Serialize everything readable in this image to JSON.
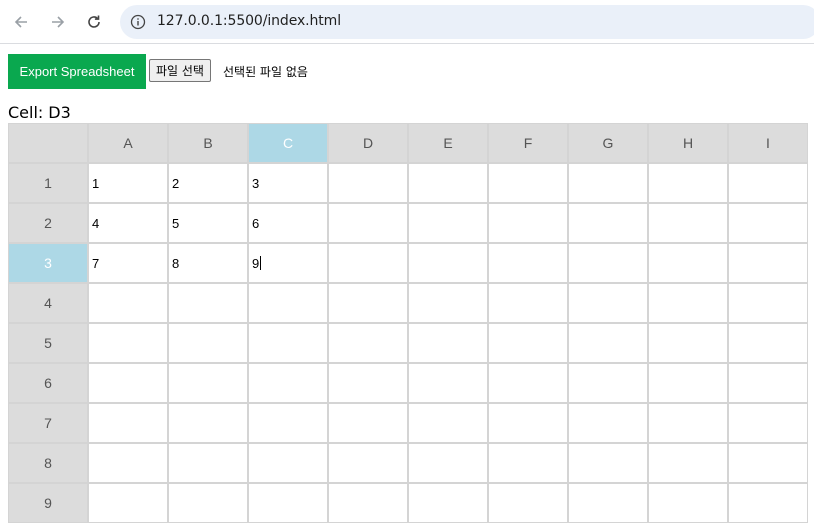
{
  "browser": {
    "url": "127.0.0.1:5500/index.html"
  },
  "toolbar": {
    "export_label": "Export Spreadsheet",
    "file_button_label": "파일 선택",
    "file_status": "선택된 파일 없음"
  },
  "cell_indicator": {
    "prefix": "Cell:",
    "value": "D3"
  },
  "sheet": {
    "columns": [
      "A",
      "B",
      "C",
      "D",
      "E",
      "F",
      "G",
      "H",
      "I"
    ],
    "rows": [
      "1",
      "2",
      "3",
      "4",
      "5",
      "6",
      "7",
      "8",
      "9"
    ],
    "active_column": "C",
    "active_row": "3",
    "cells": [
      [
        "1",
        "2",
        "3",
        "",
        "",
        "",
        "",
        "",
        ""
      ],
      [
        "4",
        "5",
        "6",
        "",
        "",
        "",
        "",
        "",
        ""
      ],
      [
        "7",
        "8",
        "9",
        "",
        "",
        "",
        "",
        "",
        ""
      ],
      [
        "",
        "",
        "",
        "",
        "",
        "",
        "",
        "",
        ""
      ],
      [
        "",
        "",
        "",
        "",
        "",
        "",
        "",
        "",
        ""
      ],
      [
        "",
        "",
        "",
        "",
        "",
        "",
        "",
        "",
        ""
      ],
      [
        "",
        "",
        "",
        "",
        "",
        "",
        "",
        "",
        ""
      ],
      [
        "",
        "",
        "",
        "",
        "",
        "",
        "",
        "",
        ""
      ],
      [
        "",
        "",
        "",
        "",
        "",
        "",
        "",
        "",
        ""
      ]
    ],
    "editing_cell": [
      2,
      2
    ]
  },
  "colors": {
    "export_button": "#0aa84f",
    "header_bg": "#dcdcdc",
    "active_header_bg": "#add8e6"
  }
}
